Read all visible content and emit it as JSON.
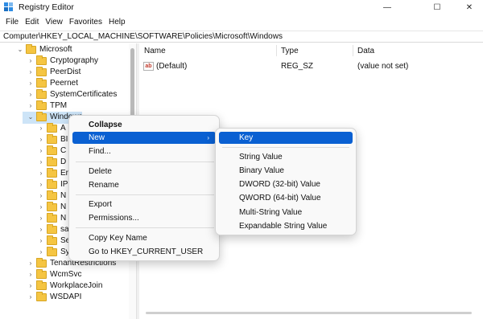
{
  "window": {
    "title": "Registry Editor",
    "controls": {
      "minimize": "—",
      "maximize": "☐",
      "close": "✕"
    }
  },
  "menubar": [
    "File",
    "Edit",
    "View",
    "Favorites",
    "Help"
  ],
  "address": "Computer\\HKEY_LOCAL_MACHINE\\SOFTWARE\\Policies\\Microsoft\\Windows",
  "tree": [
    {
      "label": "Microsoft",
      "expanded": true
    },
    {
      "label": "Cryptography",
      "expanded": false
    },
    {
      "label": "PeerDist",
      "expanded": false
    },
    {
      "label": "Peernet",
      "expanded": false
    },
    {
      "label": "SystemCertificates",
      "expanded": false
    },
    {
      "label": "TPM",
      "expanded": false
    },
    {
      "label": "Windows",
      "expanded": true,
      "selected": true
    },
    {
      "label": "A",
      "expanded": false
    },
    {
      "label": "BI",
      "expanded": false
    },
    {
      "label": "C",
      "expanded": false
    },
    {
      "label": "D",
      "expanded": false
    },
    {
      "label": "Er",
      "expanded": false
    },
    {
      "label": "IP",
      "expanded": false
    },
    {
      "label": "N",
      "expanded": false
    },
    {
      "label": "N",
      "expanded": false
    },
    {
      "label": "N",
      "expanded": false
    },
    {
      "label": "sa",
      "expanded": false
    },
    {
      "label": "Se",
      "expanded": false
    },
    {
      "label": "Sy",
      "expanded": false
    },
    {
      "label": "TenantRestrictions",
      "expanded": false
    },
    {
      "label": "WcmSvc",
      "expanded": false
    },
    {
      "label": "WorkplaceJoin",
      "expanded": false
    },
    {
      "label": "WSDAPI",
      "expanded": false
    }
  ],
  "list": {
    "columns": [
      "Name",
      "Type",
      "Data"
    ],
    "rows": [
      {
        "icon": "ab",
        "name": "(Default)",
        "type": "REG_SZ",
        "data": "(value not set)"
      }
    ]
  },
  "context_menu": {
    "items": [
      "Collapse",
      "New",
      "Find...",
      "Delete",
      "Rename",
      "Export",
      "Permissions...",
      "Copy Key Name",
      "Go to HKEY_CURRENT_USER"
    ],
    "highlighted": "New",
    "submenu_arrow": "›"
  },
  "new_submenu": {
    "items": [
      "Key",
      "String Value",
      "Binary Value",
      "DWORD (32-bit) Value",
      "QWORD (64-bit) Value",
      "Multi-String Value",
      "Expandable String Value"
    ],
    "highlighted": "Key"
  },
  "colors": {
    "selection": "#0a60d2",
    "tree_selected": "#cde4f7",
    "folder": "#f5c542"
  }
}
